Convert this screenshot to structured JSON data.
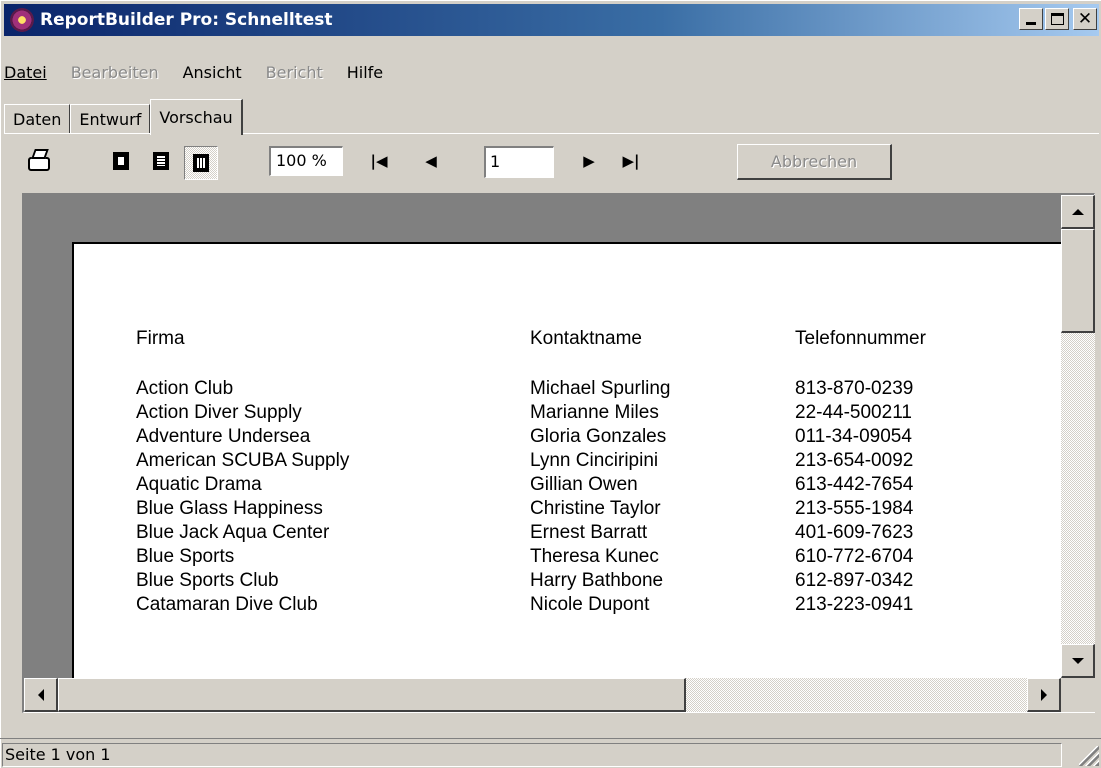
{
  "window": {
    "title": "ReportBuilder Pro: Schnelltest",
    "close_glyph": "✕"
  },
  "menu": {
    "items": [
      {
        "label": "Datei",
        "enabled": true
      },
      {
        "label": "Bearbeiten",
        "enabled": false
      },
      {
        "label": "Ansicht",
        "enabled": true
      },
      {
        "label": "Bericht",
        "enabled": false
      },
      {
        "label": "Hilfe",
        "enabled": true
      }
    ]
  },
  "tabs": [
    {
      "label": "Daten",
      "active": false
    },
    {
      "label": "Entwurf",
      "active": false
    },
    {
      "label": "Vorschau",
      "active": true
    }
  ],
  "toolbar": {
    "zoom": "100 %",
    "page": "1",
    "first_glyph": "|◀",
    "prev_glyph": "◀",
    "next_glyph": "▶",
    "last_glyph": "▶|",
    "cancel_label": "Abbrechen"
  },
  "report": {
    "headers": {
      "company": "Firma",
      "contact": "Kontaktname",
      "phone": "Telefonnummer"
    },
    "rows": [
      {
        "company": "Action Club",
        "contact": "Michael Spurling",
        "phone": "813-870-0239"
      },
      {
        "company": "Action Diver Supply",
        "contact": "Marianne Miles",
        "phone": "22-44-500211"
      },
      {
        "company": "Adventure Undersea",
        "contact": "Gloria Gonzales",
        "phone": "011-34-09054"
      },
      {
        "company": "American SCUBA Supply",
        "contact": "Lynn Cinciripini",
        "phone": "213-654-0092"
      },
      {
        "company": "Aquatic Drama",
        "contact": "Gillian Owen",
        "phone": "613-442-7654"
      },
      {
        "company": "Blue Glass Happiness",
        "contact": "Christine Taylor",
        "phone": "213-555-1984"
      },
      {
        "company": "Blue Jack Aqua Center",
        "contact": "Ernest Barratt",
        "phone": "401-609-7623"
      },
      {
        "company": "Blue Sports",
        "contact": "Theresa Kunec",
        "phone": "610-772-6704"
      },
      {
        "company": "Blue Sports Club",
        "contact": "Harry Bathbone",
        "phone": "612-897-0342"
      },
      {
        "company": "Catamaran Dive Club",
        "contact": "Nicole Dupont",
        "phone": "213-223-0941"
      }
    ]
  },
  "status": {
    "text": "Seite 1 von 1"
  }
}
